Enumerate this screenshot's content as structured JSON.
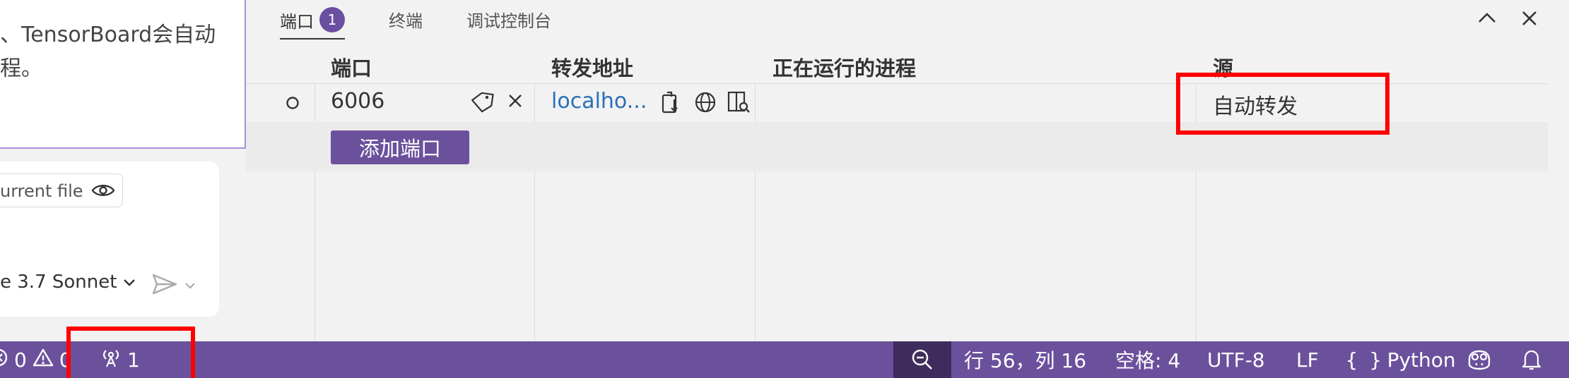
{
  "left": {
    "tooltip_line1": "、TensorBoard会自动",
    "tooltip_line2": "程。",
    "context_chip_label": "urrent file",
    "model_label": "e 3.7 Sonnet"
  },
  "panel": {
    "tabs": [
      {
        "label": "端口",
        "badge": "1",
        "active": true
      },
      {
        "label": "终端"
      },
      {
        "label": "调试控制台"
      }
    ],
    "columns": [
      "端口",
      "转发地址",
      "正在运行的进程",
      "源"
    ],
    "row": {
      "port": "6006",
      "address": "localho...",
      "process": "",
      "origin": "自动转发"
    },
    "add_port_label": "添加端口"
  },
  "statusbar": {
    "errors": "0",
    "warnings": "0",
    "ports_count": "1",
    "position": "行 56，列 16",
    "spaces": "空格: 4",
    "encoding": "UTF-8",
    "eol": "LF",
    "language": "Python"
  },
  "colors": {
    "accent": "#6b519c",
    "badge": "#6b4fa0",
    "link": "#2a6fb8",
    "highlight": "#ff0000"
  }
}
